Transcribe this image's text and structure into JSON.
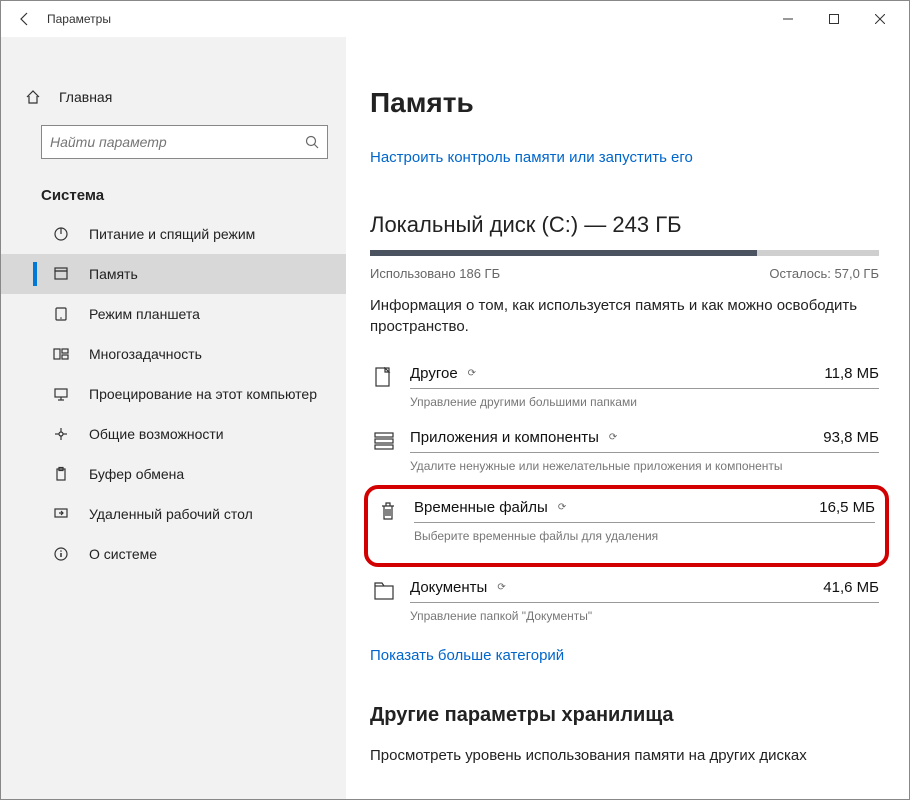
{
  "window": {
    "title": "Параметры"
  },
  "sidebar": {
    "home": "Главная",
    "search_placeholder": "Найти параметр",
    "section": "Система",
    "items": [
      {
        "label": "Питание и спящий режим",
        "icon": "power-icon",
        "selected": false
      },
      {
        "label": "Память",
        "icon": "storage-icon",
        "selected": true
      },
      {
        "label": "Режим планшета",
        "icon": "tablet-icon",
        "selected": false
      },
      {
        "label": "Многозадачность",
        "icon": "multitask-icon",
        "selected": false
      },
      {
        "label": "Проецирование на этот компьютер",
        "icon": "projecting-icon",
        "selected": false
      },
      {
        "label": "Общие возможности",
        "icon": "shared-icon",
        "selected": false
      },
      {
        "label": "Буфер обмена",
        "icon": "clipboard-icon",
        "selected": false
      },
      {
        "label": "Удаленный рабочий стол",
        "icon": "remote-icon",
        "selected": false
      },
      {
        "label": "О системе",
        "icon": "about-icon",
        "selected": false
      }
    ]
  },
  "main": {
    "heading": "Память",
    "configure_link": "Настроить контроль памяти или запустить его",
    "disk_title": "Локальный диск (C:) — 243 ГБ",
    "used_label": "Использовано 186 ГБ",
    "free_label": "Осталось: 57,0 ГБ",
    "usage_percent": 76,
    "description": "Информация о том, как используется память и как можно освободить пространство.",
    "categories": [
      {
        "name": "Другое",
        "size": "11,8 МБ",
        "sub": "Управление другими большими папками",
        "icon": "other-icon"
      },
      {
        "name": "Приложения и компоненты",
        "size": "93,8 МБ",
        "sub": "Удалите ненужные или нежелательные приложения и компоненты",
        "icon": "apps-icon"
      },
      {
        "name": "Временные файлы",
        "size": "16,5 МБ",
        "sub": "Выберите временные файлы для удаления",
        "icon": "trash-icon",
        "highlighted": true
      },
      {
        "name": "Документы",
        "size": "41,6 МБ",
        "sub": "Управление папкой \"Документы\"",
        "icon": "documents-icon"
      }
    ],
    "more_link": "Показать больше категорий",
    "other_section": "Другие параметры хранилища",
    "other_desc": "Просмотреть уровень использования памяти на других дисках"
  }
}
